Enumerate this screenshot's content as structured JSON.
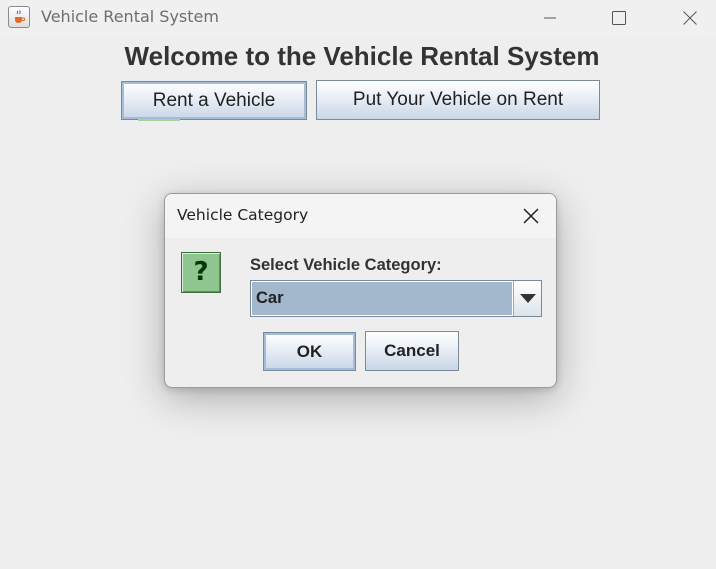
{
  "window": {
    "title": "Vehicle Rental System",
    "icon": "java-cup-icon",
    "controls": {
      "minimize": "minimize-icon",
      "maximize": "maximize-icon",
      "close": "close-icon"
    }
  },
  "main": {
    "welcome_text": "Welcome to the Vehicle Rental System",
    "rent_button_label": "Rent a Vehicle",
    "put_on_rent_button_label": "Put Your Vehicle on Rent"
  },
  "dialog": {
    "title": "Vehicle Category",
    "icon": "question-icon",
    "icon_glyph": "?",
    "prompt": "Select Vehicle Category:",
    "combo": {
      "selected": "Car"
    },
    "ok_label": "OK",
    "cancel_label": "Cancel"
  },
  "colors": {
    "button_gradient_bottom": "#c8d6e6",
    "combo_selection": "#a3b8cc",
    "question_icon_bg": "#8fc68f"
  }
}
